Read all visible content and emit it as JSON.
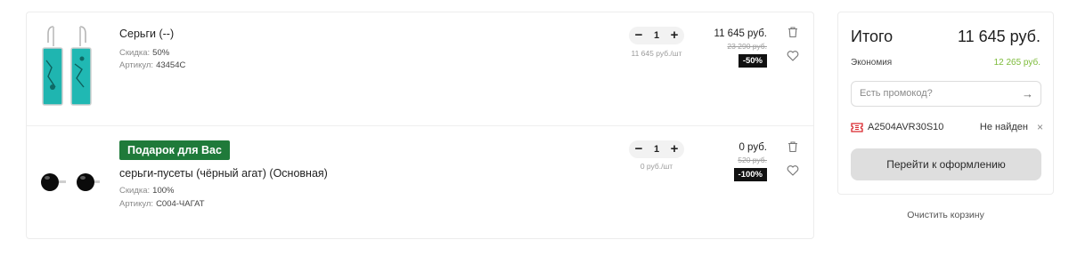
{
  "cart": {
    "items": [
      {
        "name": "Серьги (--)",
        "discount_label": "Скидка:",
        "discount_value": "50%",
        "article_label": "Артикул:",
        "article_value": "43454С",
        "qty": "1",
        "unit_price": "11 645 руб./шт",
        "price": "11 645 руб.",
        "old_price": "23 290 руб.",
        "discount_badge": "-50%",
        "thumb_icon": "turquoise-earrings-image"
      },
      {
        "gift_badge": "Подарок для Вас",
        "name": "серьги-пусеты (чёрный агат) (Основная)",
        "discount_label": "Скидка:",
        "discount_value": "100%",
        "article_label": "Артикул:",
        "article_value": "С004-ЧАГАТ",
        "qty": "1",
        "unit_price": "0 руб./шт",
        "price": "0 руб.",
        "old_price": "520 руб.",
        "discount_badge": "-100%",
        "thumb_icon": "black-agate-stud-earrings-image"
      }
    ],
    "stepper": {
      "minus": "−",
      "plus": "+"
    }
  },
  "summary": {
    "title": "Итого",
    "total": "11 645 руб.",
    "savings_label": "Экономия",
    "savings_value": "12 265 руб.",
    "promo_placeholder": "Есть промокод?",
    "promo_arrow": "→",
    "applied_code": "A2504AVR30S10",
    "code_status": "Не найден",
    "code_remove": "×",
    "checkout_label": "Перейти к оформлению"
  },
  "clear_cart_label": "Очистить корзину",
  "colors": {
    "gift_green": "#1f7a3a",
    "savings_green": "#7dbb3a",
    "ticket_red": "#d9262c"
  }
}
